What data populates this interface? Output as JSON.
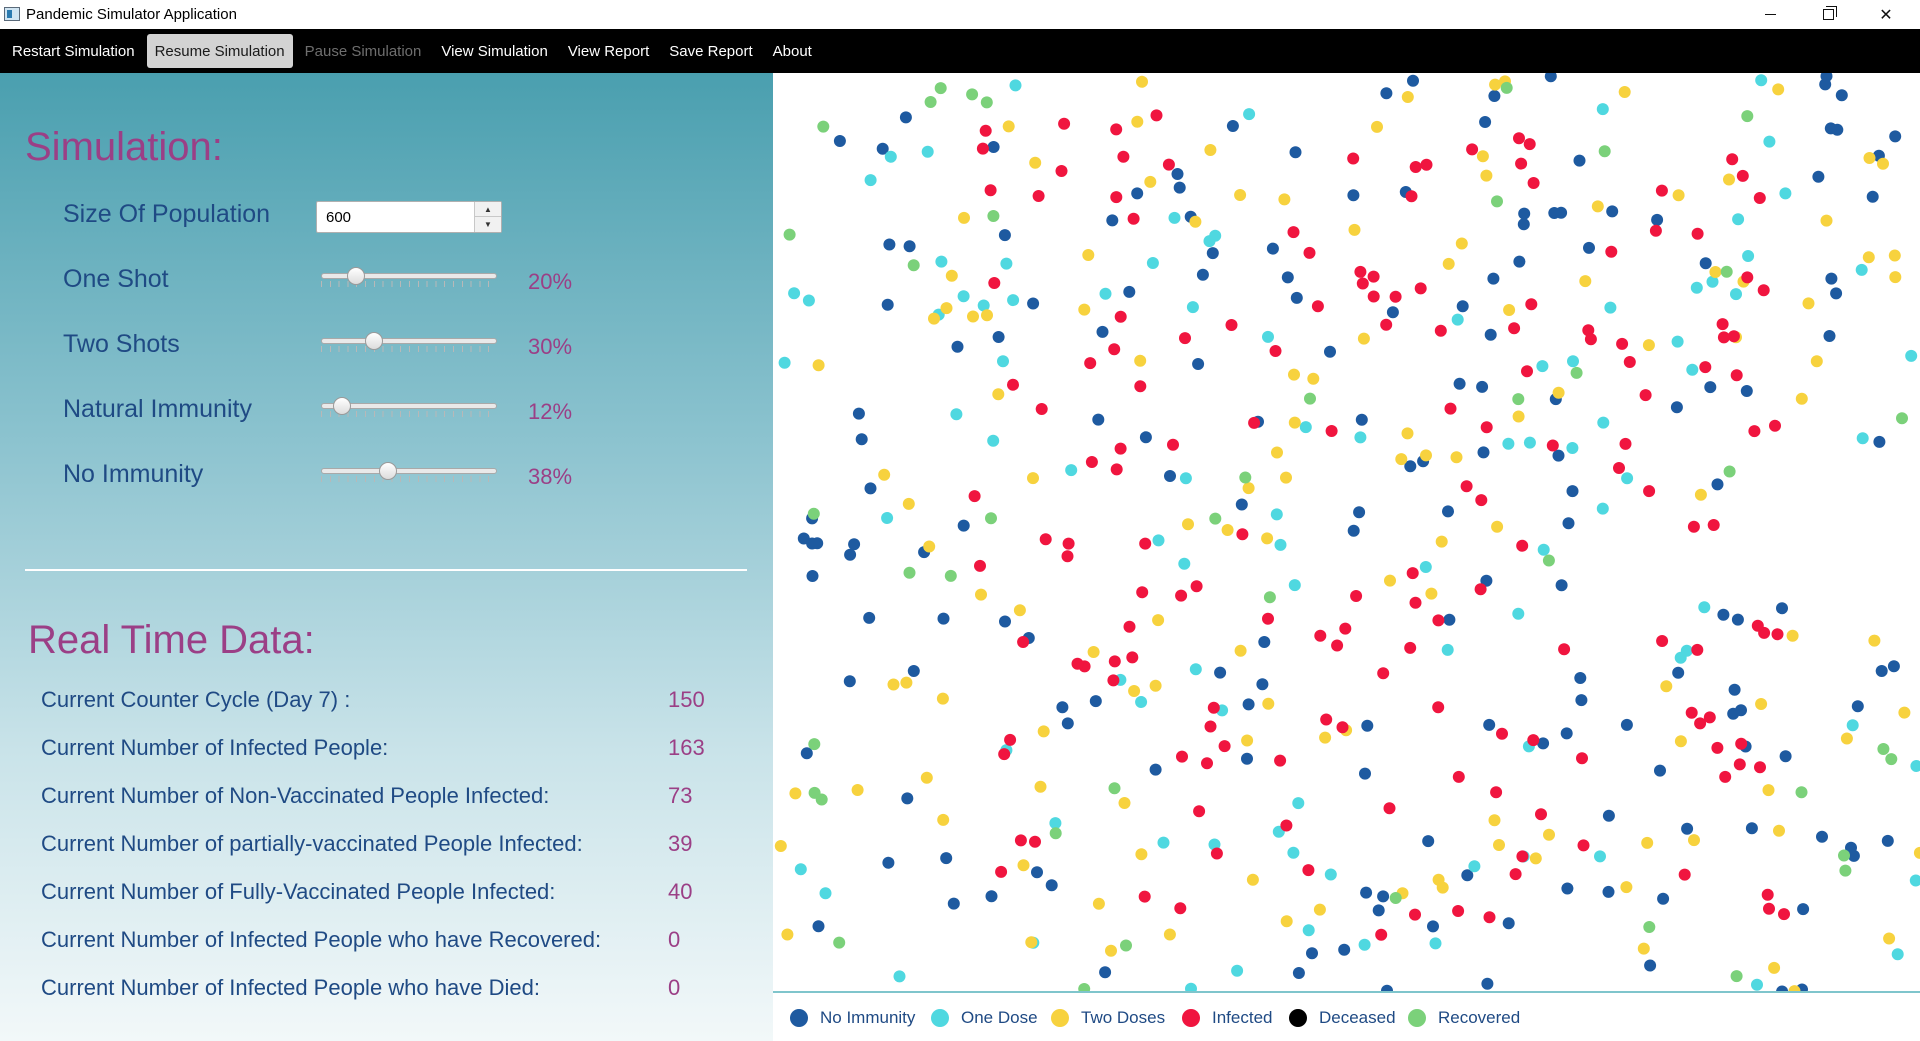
{
  "window": {
    "title": "Pandemic Simulator Application",
    "minimize": "—",
    "maximize": "❐",
    "close": "✕"
  },
  "menu": {
    "items": [
      {
        "label": "Restart Simulation",
        "state": "normal"
      },
      {
        "label": "Resume Simulation",
        "state": "active"
      },
      {
        "label": "Pause Simulation",
        "state": "disabled"
      },
      {
        "label": "View Simulation",
        "state": "normal"
      },
      {
        "label": "View Report",
        "state": "normal"
      },
      {
        "label": "Save Report",
        "state": "normal"
      },
      {
        "label": "About",
        "state": "normal"
      }
    ]
  },
  "simulation": {
    "title": "Simulation:",
    "population_label": "Size Of Population",
    "population_value": "600",
    "sliders": [
      {
        "label": "One Shot",
        "value_text": "20%",
        "value": 20
      },
      {
        "label": "Two Shots",
        "value_text": "30%",
        "value": 30
      },
      {
        "label": "Natural Immunity",
        "value_text": "12%",
        "value": 12
      },
      {
        "label": "No Immunity",
        "value_text": "38%",
        "value": 38
      }
    ]
  },
  "realtime": {
    "title": "Real Time Data:",
    "rows": [
      {
        "label": "Current Counter Cycle (Day 7) :",
        "value": "150"
      },
      {
        "label": "Current Number of Infected People:",
        "value": "163"
      },
      {
        "label": "Current Number of Non-Vaccinated People Infected:",
        "value": "73"
      },
      {
        "label": "Current Number of partially-vaccinated People Infected:",
        "value": "39"
      },
      {
        "label": "Current Number of Fully-Vaccinated People Infected:",
        "value": "40"
      },
      {
        "label": "Current Number of Infected People who have Recovered:",
        "value": "0"
      },
      {
        "label": "Current Number of Infected People who have Died:",
        "value": "0"
      }
    ]
  },
  "legend": [
    {
      "label": "No Immunity",
      "color": "#1e5aa0"
    },
    {
      "label": "One Dose",
      "color": "#4fd8e0"
    },
    {
      "label": "Two Doses",
      "color": "#f7d23e"
    },
    {
      "label": "Infected",
      "color": "#f0153f"
    },
    {
      "label": "Deceased",
      "color": "#000000"
    },
    {
      "label": "Recovered",
      "color": "#7bd17a"
    }
  ],
  "population_counts": {
    "no_immunity": 170,
    "one_dose": 95,
    "two_doses": 130,
    "infected": 163,
    "recovered": 42
  }
}
